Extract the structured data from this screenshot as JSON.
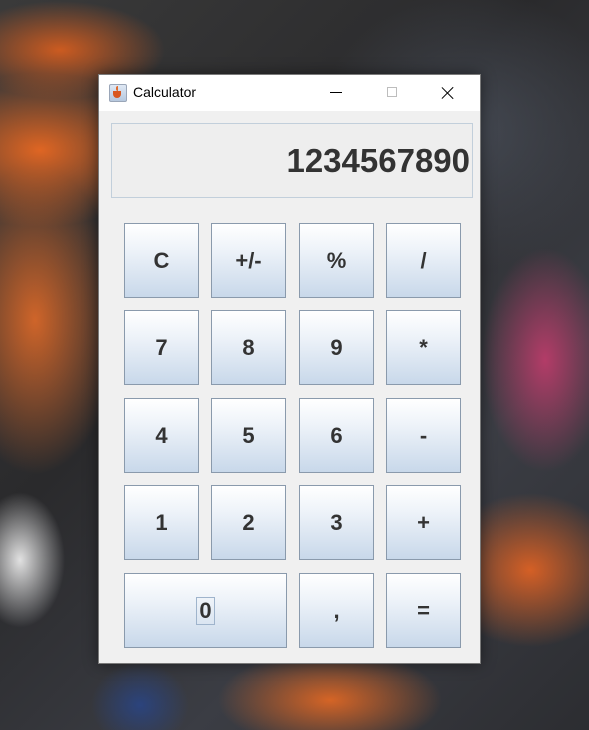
{
  "window": {
    "title": "Calculator"
  },
  "display": {
    "value": "1234567890"
  },
  "keys": {
    "clear": "C",
    "sign": "+/-",
    "percent": "%",
    "divide": "/",
    "seven": "7",
    "eight": "8",
    "nine": "9",
    "multiply": "*",
    "four": "4",
    "five": "5",
    "six": "6",
    "subtract": "-",
    "one": "1",
    "two": "2",
    "three": "3",
    "add": "+",
    "zero": "0",
    "decimal": ",",
    "equals": "="
  },
  "icons": {
    "app": "java-cup-icon",
    "minimize": "minimize-icon",
    "maximize": "maximize-icon",
    "close": "close-icon"
  },
  "colors": {
    "button_top": "#ffffff",
    "button_bottom": "#c8d8ea",
    "button_border": "#8a9aac",
    "text": "#333333",
    "window_bg": "#f0f0f0"
  }
}
